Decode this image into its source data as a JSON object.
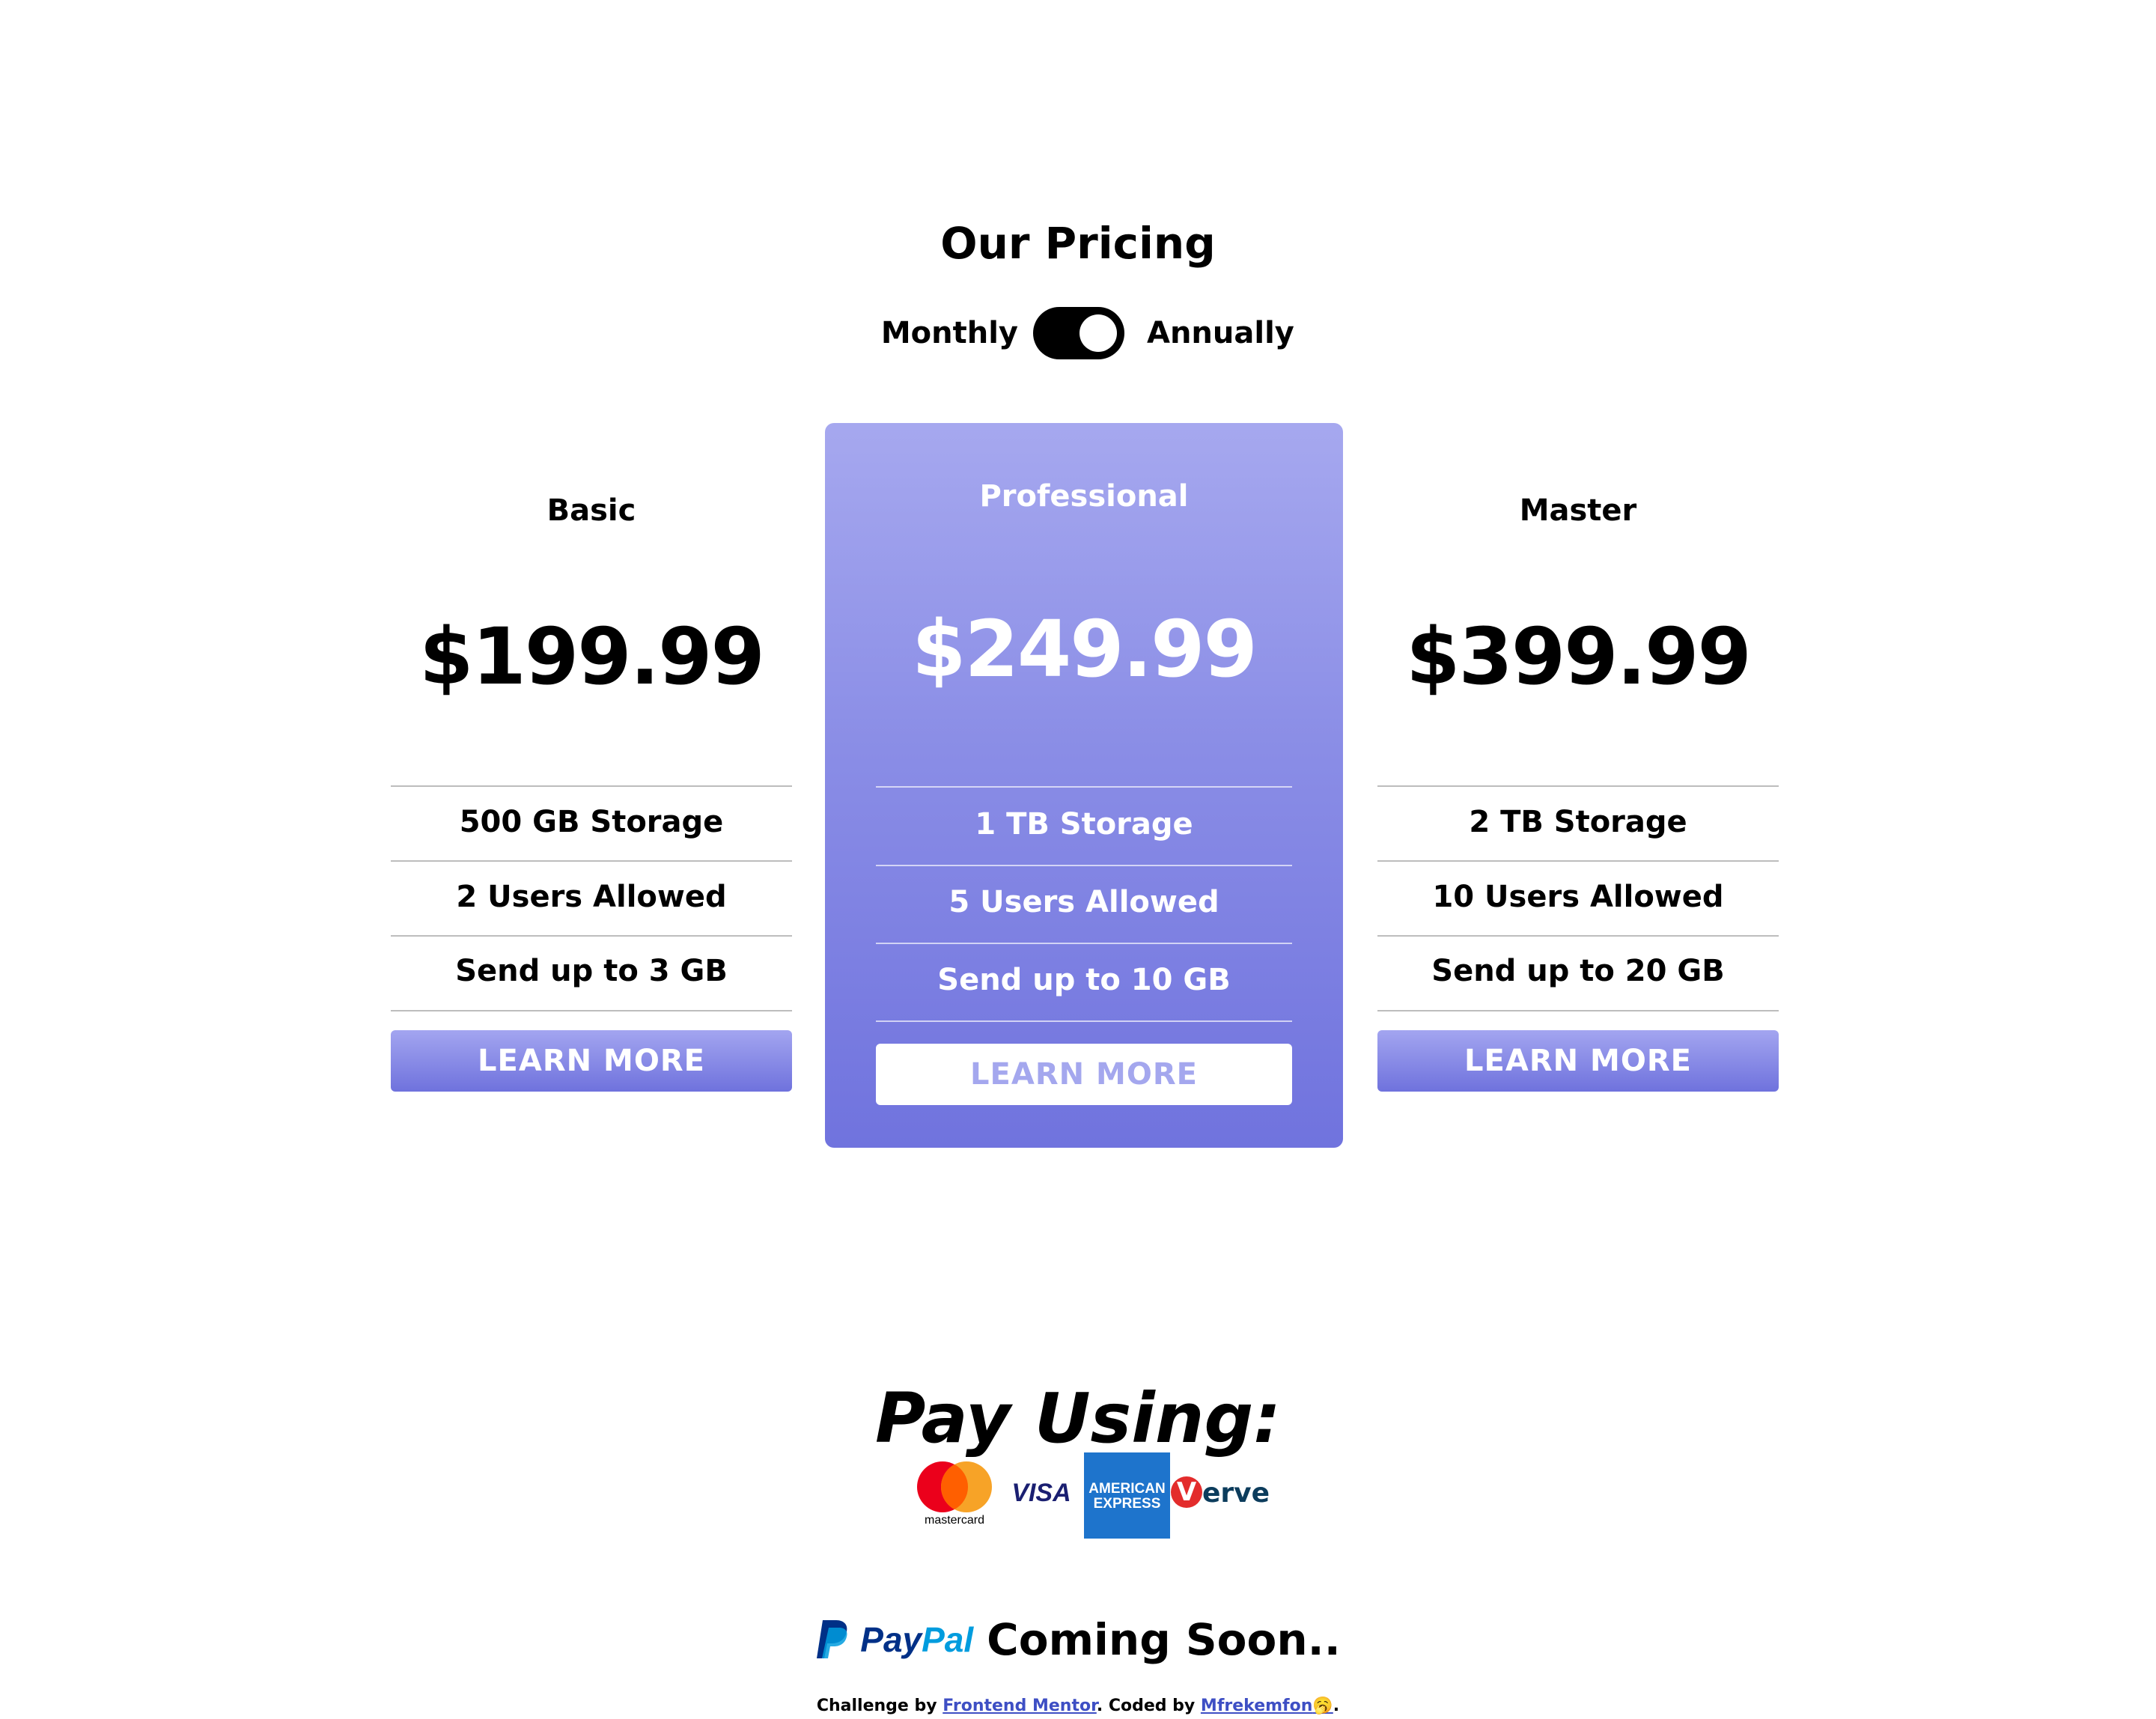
{
  "title": "Our Pricing",
  "toggle": {
    "left_label": "Monthly",
    "right_label": "Annually",
    "state": "annually"
  },
  "plans": [
    {
      "name": "Basic",
      "price": "$199.99",
      "features": [
        "500 GB Storage",
        "2 Users Allowed",
        "Send up to 3 GB"
      ],
      "button_label": "LEARN MORE"
    },
    {
      "name": "Professional",
      "price": "$249.99",
      "features": [
        "1 TB Storage",
        "5 Users Allowed",
        "Send up to 10 GB"
      ],
      "button_label": "LEARN MORE",
      "highlighted": true
    },
    {
      "name": "Master",
      "price": "$399.99",
      "features": [
        "2 TB Storage",
        "10 Users Allowed",
        "Send up to 20 GB"
      ],
      "button_label": "LEARN MORE"
    }
  ],
  "payment": {
    "title": "Pay Using:",
    "logos": {
      "mastercard": "mastercard",
      "visa": "VISA",
      "amex_line1": "AMERICAN",
      "amex_line2": "EXPRESS",
      "verve_v": "V",
      "verve_rest": "erve"
    },
    "icons": [
      "mastercard-icon",
      "visa-icon",
      "amex-icon",
      "verve-icon"
    ]
  },
  "paypal": {
    "pay": "Pay",
    "pal": "Pal",
    "coming_soon": "Coming Soon.."
  },
  "footer": {
    "prefix": "Challenge by ",
    "link1": "Frontend Mentor",
    "middle": ". Coded by ",
    "link2": "Mfrekemfon",
    "emoji": "🥱",
    "suffix": "."
  },
  "colors": {
    "accent_top": "#a6a8ef",
    "accent_bottom": "#6f72dd",
    "link": "#3e4fc4"
  }
}
